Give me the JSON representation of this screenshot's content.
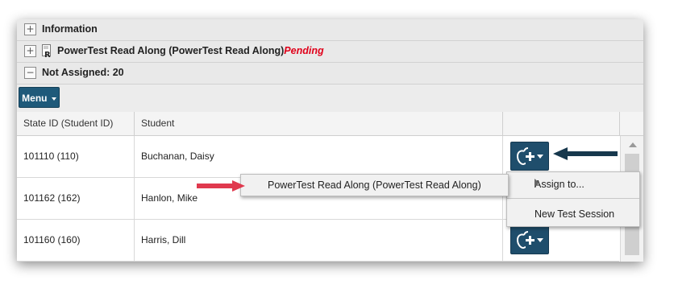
{
  "sections": {
    "information": {
      "toggle": "+",
      "title": "Information"
    },
    "test": {
      "toggle": "+",
      "title": "PowerTest Read Along (PowerTest Read Along)",
      "status": "Pending"
    },
    "not_assigned": {
      "toggle": "−",
      "title": "Not Assigned: 20"
    }
  },
  "toolbar": {
    "menu_label": "Menu"
  },
  "table": {
    "headers": [
      "State ID (Student ID)",
      "Student"
    ],
    "rows": [
      {
        "id": "101110 (110)",
        "student": "Buchanan, Daisy"
      },
      {
        "id": "101162 (162)",
        "student": "Hanlon, Mike"
      },
      {
        "id": "101160 (160)",
        "student": "Harris, Dill"
      }
    ]
  },
  "assign_menu": {
    "assign_to": "Assign to...",
    "new_session": "New Test Session"
  },
  "submenu": {
    "test_option": "PowerTest Read Along (PowerTest Read Along)"
  },
  "colors": {
    "accent": "#1f5a7a",
    "pending": "#e0001a",
    "arrow_red": "#e0394e",
    "arrow_dark": "#17384d"
  },
  "icons": {
    "assign": "apple-plus-icon",
    "toggle": "expand-collapse-icon",
    "report": "report-doc-icon"
  }
}
